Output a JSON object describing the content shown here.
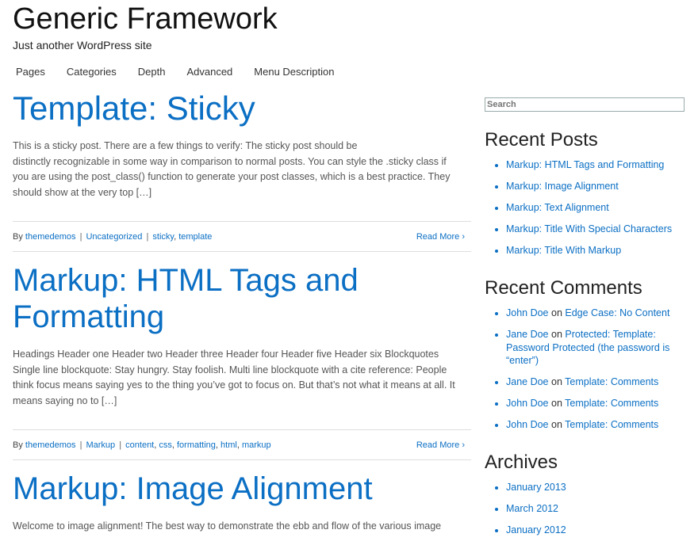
{
  "site": {
    "title": "Generic Framework",
    "description": "Just another WordPress site"
  },
  "nav": {
    "items": [
      "Pages",
      "Categories",
      "Depth",
      "Advanced",
      "Menu Description"
    ]
  },
  "posts": [
    {
      "title": "Template: Sticky",
      "excerpt_lines": [
        "This is a sticky post. There are a few things to verify: The sticky post should be",
        "distinctly recognizable in some way in comparison to normal posts. You can style the .sticky class if",
        "you are using the post_class() function to generate your post classes, which is a best practice. They",
        "should show at the very top […]"
      ],
      "meta": {
        "by": "By",
        "author": "themedemos",
        "category": "Uncategorized",
        "tags": [
          "sticky",
          "template"
        ],
        "read_more": "Read More"
      }
    },
    {
      "title_lines": [
        "Markup: HTML Tags and",
        "Formatting"
      ],
      "excerpt_lines": [
        "Headings Header one Header two Header three Header four Header five Header six Blockquotes",
        "Single line blockquote: Stay hungry. Stay foolish. Multi line blockquote with a cite reference: People",
        "think focus means saying yes to the thing you’ve got to focus on. But that’s not what it means at all. It",
        "means saying no to […]"
      ],
      "meta": {
        "by": "By",
        "author": "themedemos",
        "category": "Markup",
        "tags": [
          "content",
          "css",
          "formatting",
          "html",
          "markup"
        ],
        "read_more": "Read More"
      }
    },
    {
      "title": "Markup: Image Alignment",
      "excerpt_partial": "Welcome to image alignment! The best way to demonstrate the ebb and flow of the various image"
    }
  ],
  "sidebar": {
    "search_placeholder": "Search",
    "recent_posts": {
      "title": "Recent Posts",
      "items": [
        "Markup: HTML Tags and Formatting",
        "Markup: Image Alignment",
        "Markup: Text Alignment",
        "Markup: Title With Special Characters",
        "Markup: Title With Markup"
      ]
    },
    "recent_comments": {
      "title": "Recent Comments",
      "on_word": "on",
      "items": [
        {
          "author": "John Doe",
          "post": "Edge Case: No Content"
        },
        {
          "author": "Jane Doe",
          "post": "Protected: Template: Password Protected (the password is “enter”)"
        },
        {
          "author": "Jane Doe",
          "post": "Template: Comments"
        },
        {
          "author": "John Doe",
          "post": "Template: Comments"
        },
        {
          "author": "John Doe",
          "post": "Template: Comments"
        }
      ]
    },
    "archives": {
      "title": "Archives",
      "items": [
        "January 2013",
        "March 2012",
        "January 2012"
      ]
    }
  },
  "colors": {
    "link": "#0b6fc4",
    "text": "#333333"
  }
}
